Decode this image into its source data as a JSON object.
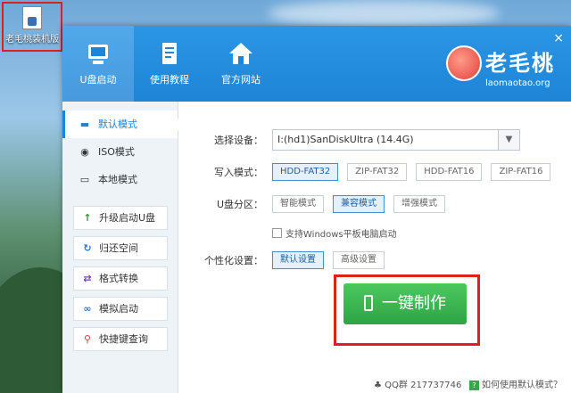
{
  "desktop": {
    "icon_label": "老毛桃装机版"
  },
  "window": {
    "close_glyph": "×",
    "top_nav": [
      {
        "label": "U盘启动",
        "icon": "usb-drive-icon",
        "active": true
      },
      {
        "label": "使用教程",
        "icon": "document-icon",
        "active": false
      },
      {
        "label": "官方网站",
        "icon": "home-icon",
        "active": false
      }
    ],
    "logo": {
      "name": "老毛桃",
      "url": "laomaotao.org"
    }
  },
  "sidebar": {
    "modes": [
      {
        "label": "默认模式",
        "icon": "usb-drive-icon",
        "active": true
      },
      {
        "label": "ISO模式",
        "icon": "disc-icon",
        "active": false
      },
      {
        "label": "本地模式",
        "icon": "monitor-icon",
        "active": false
      }
    ],
    "tools": [
      {
        "label": "升级启动U盘",
        "icon": "arrow-up-icon",
        "color": "#2e9b3c"
      },
      {
        "label": "归还空间",
        "icon": "refresh-icon",
        "color": "#2a78c8"
      },
      {
        "label": "格式转换",
        "icon": "swap-icon",
        "color": "#7b3fb6"
      },
      {
        "label": "模拟启动",
        "icon": "link-icon",
        "color": "#2a78c8"
      },
      {
        "label": "快捷键查询",
        "icon": "search-icon",
        "color": "#d43a3a"
      }
    ]
  },
  "form": {
    "device_label": "选择设备：",
    "device_value": "I:(hd1)SanDiskUltra (14.4G)",
    "write_mode_label": "写入模式：",
    "write_modes": [
      "HDD-FAT32",
      "ZIP-FAT32",
      "HDD-FAT16",
      "ZIP-FAT16"
    ],
    "write_mode_selected": "HDD-FAT32",
    "partition_label": "U盘分区：",
    "partitions": [
      "智能模式",
      "兼容模式",
      "增强模式"
    ],
    "partition_selected": "兼容模式",
    "tablet_checkbox_label": "支持Windows平板电脑启动",
    "tablet_checked": false,
    "personalize_label": "个性化设置：",
    "personalize_options": [
      "默认设置",
      "高级设置"
    ],
    "personalize_selected": "默认设置",
    "make_button_label": "一键制作"
  },
  "footer": {
    "qq_text": "QQ群 217737746",
    "help_text": "如何使用默认模式？"
  },
  "colors": {
    "accent": "#1e84d6",
    "make_button": "#2ea445",
    "highlight_frame": "#e0201c"
  }
}
